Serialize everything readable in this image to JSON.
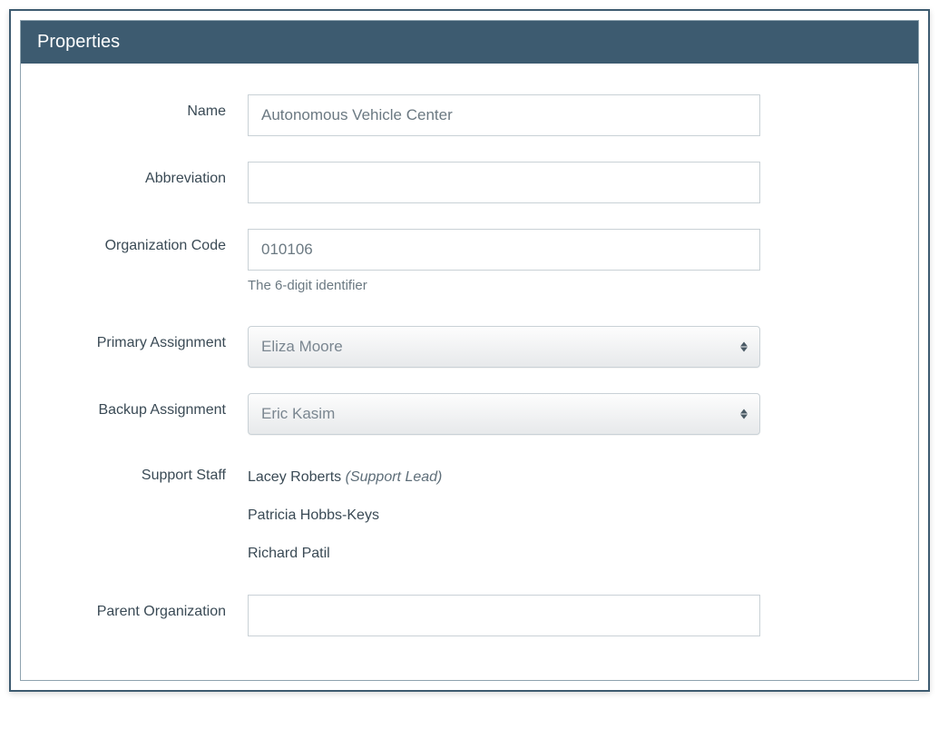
{
  "panel": {
    "title": "Properties"
  },
  "fields": {
    "name": {
      "label": "Name",
      "value": "Autonomous Vehicle Center"
    },
    "abbreviation": {
      "label": "Abbreviation",
      "value": ""
    },
    "orgcode": {
      "label": "Organization Code",
      "value": "010106",
      "help": "The 6-digit identifier"
    },
    "primary": {
      "label": "Primary Assignment",
      "value": "Eliza Moore"
    },
    "backup": {
      "label": "Backup Assignment",
      "value": "Eric Kasim"
    },
    "support": {
      "label": "Support Staff",
      "staff": [
        {
          "name": "Lacey Roberts",
          "role": "(Support Lead)"
        },
        {
          "name": "Patricia Hobbs-Keys",
          "role": ""
        },
        {
          "name": "Richard Patil",
          "role": ""
        }
      ]
    },
    "parent": {
      "label": "Parent Organization",
      "value": ""
    }
  }
}
